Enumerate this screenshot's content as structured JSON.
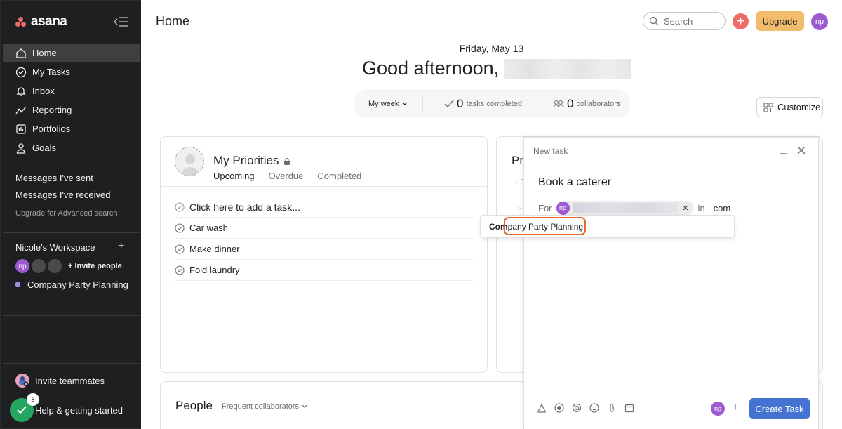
{
  "app": {
    "name": "asana"
  },
  "sidebar": {
    "nav": [
      {
        "label": "Home",
        "icon": "home-icon"
      },
      {
        "label": "My Tasks",
        "icon": "check-circle-icon"
      },
      {
        "label": "Inbox",
        "icon": "bell-icon"
      },
      {
        "label": "Reporting",
        "icon": "chart-line-icon"
      },
      {
        "label": "Portfolios",
        "icon": "bar-chart-icon"
      },
      {
        "label": "Goals",
        "icon": "person-icon"
      }
    ],
    "messages_sent": "Messages I've sent",
    "messages_received": "Messages I've received",
    "upgrade_search": "Upgrade for Advanced search",
    "workspace": {
      "title": "Nicole's Workspace",
      "avatar_initials": "np",
      "invite_people": "+ Invite people",
      "project": "Company Party Planning"
    },
    "invite_teammates": "Invite teammates",
    "help": "Help & getting started",
    "help_badge_count": "8"
  },
  "header": {
    "title": "Home",
    "search_placeholder": "Search",
    "upgrade_label": "Upgrade",
    "avatar_initials": "np"
  },
  "greeting": {
    "date": "Friday, May 13",
    "text": "Good afternoon,"
  },
  "stats": {
    "period": "My week",
    "tasks_completed_count": "0",
    "tasks_completed_label": "tasks completed",
    "collaborators_count": "0",
    "collaborators_label": "collaborators"
  },
  "customize_label": "Customize",
  "priorities": {
    "title": "My Priorities",
    "tabs": [
      "Upcoming",
      "Overdue",
      "Completed"
    ],
    "add_task": "Click here to add a task...",
    "tasks": [
      "Car wash",
      "Make dinner",
      "Fold laundry"
    ]
  },
  "projects_card": {
    "title_partial": "Pr"
  },
  "people": {
    "title": "People",
    "filter": "Frequent collaborators"
  },
  "new_task": {
    "header": "New task",
    "task_name": "Book a caterer",
    "for_label": "For",
    "assignee_initials": "np",
    "in_label": "in",
    "project_query": "com",
    "create_label": "Create Task",
    "avatar_initials": "np"
  },
  "suggestion": {
    "match": "Com",
    "rest": "pany Party Planning"
  },
  "colors": {
    "sidebar_bg": "#1e1f21",
    "accent_coral": "#f06a6a",
    "upgrade": "#f1bd6c",
    "avatar_purple": "#9e5bd1",
    "primary_blue": "#4573d2",
    "highlight": "#e8672a"
  }
}
